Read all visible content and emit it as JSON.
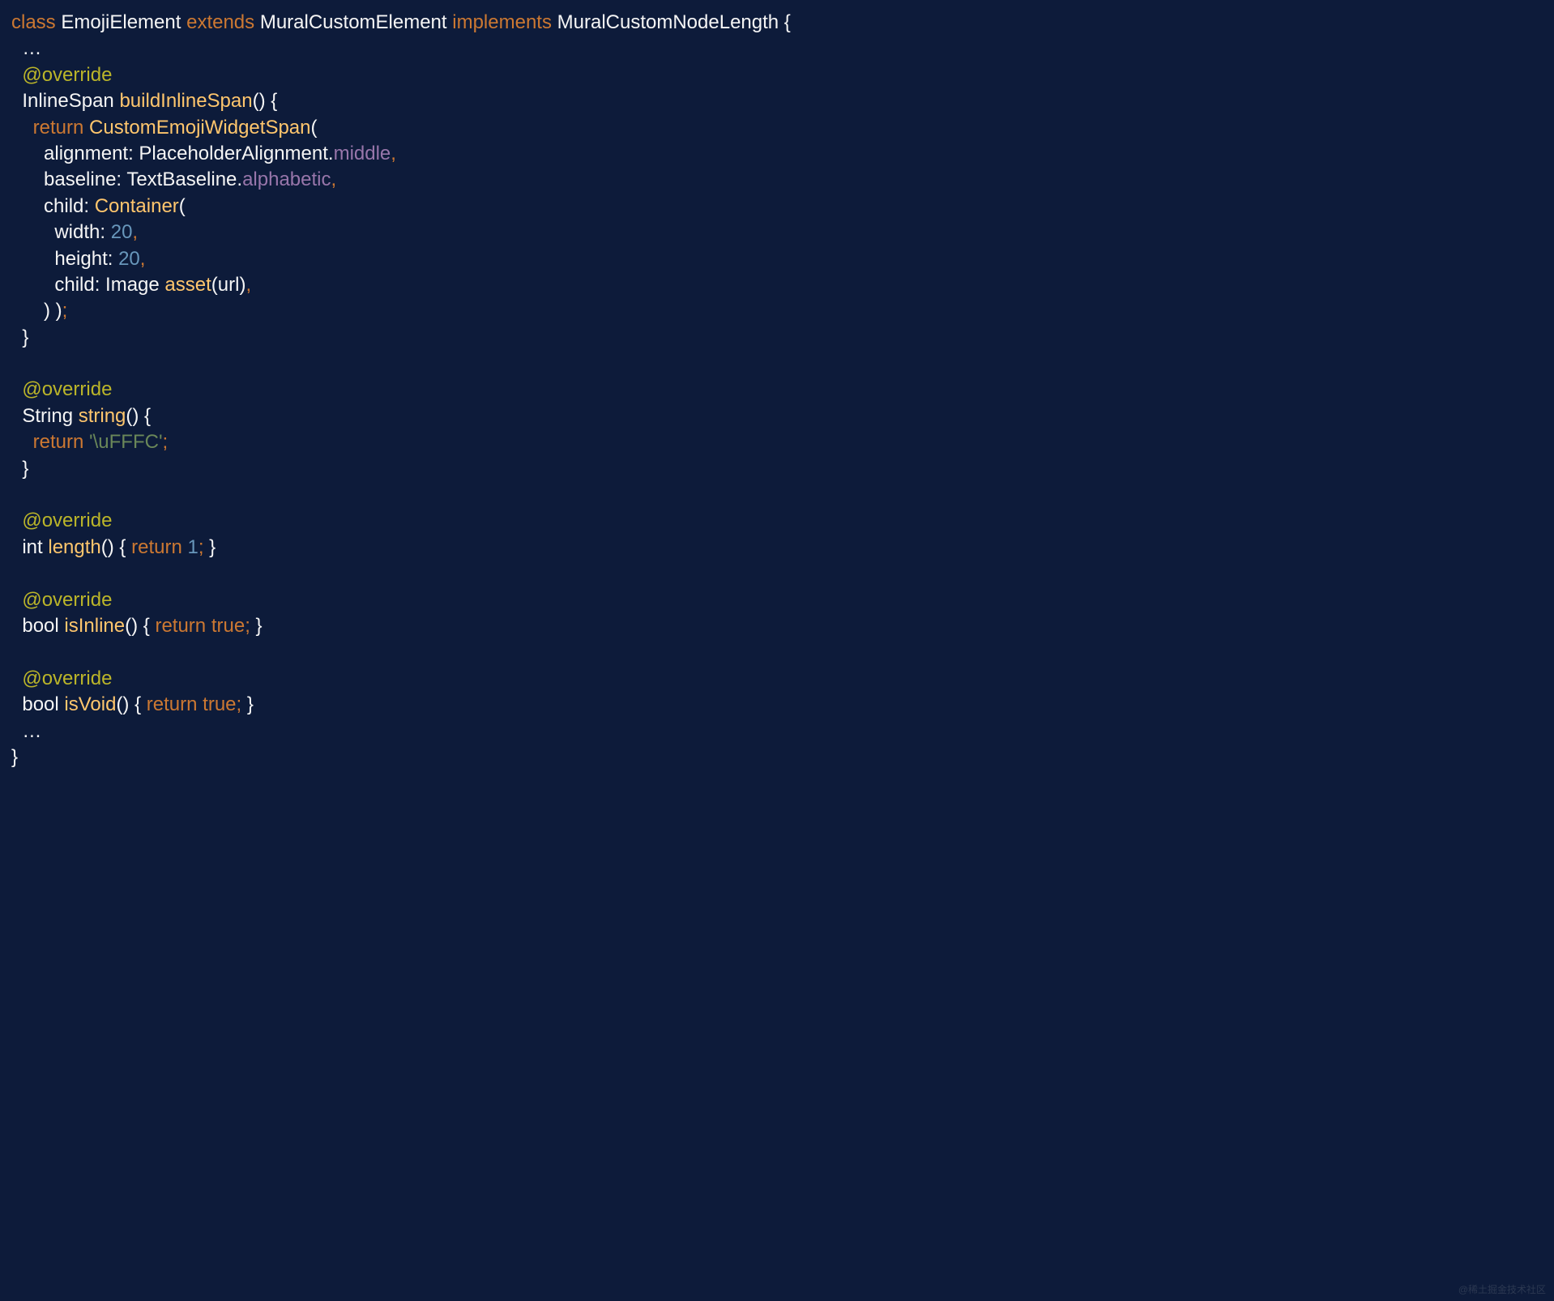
{
  "code": {
    "l1": {
      "kw1": "class",
      "cls": "EmojiElement",
      "kw2": "extends",
      "sup": "MuralCustomElement",
      "kw3": "implements",
      "iface": "MuralCustomNodeLength",
      "b": "{"
    },
    "l2": {
      "dots": "…"
    },
    "l3": {
      "ann": "@override"
    },
    "l4": {
      "type": "InlineSpan",
      "fn": "buildInlineSpan",
      "p": "() {"
    },
    "l5": {
      "kw": "return",
      "fn": "CustomEmojiWidgetSpan",
      "p": "("
    },
    "l6": {
      "param": "alignment: ",
      "cls": "PlaceholderAlignment",
      "dot": ".",
      "enum": "middle",
      "c": ","
    },
    "l7": {
      "param": "baseline: ",
      "cls": "TextBaseline",
      "dot": ".",
      "enum": "alphabetic",
      "c": ","
    },
    "l8": {
      "param": "child: ",
      "fn": "Container",
      "p": "("
    },
    "l9": {
      "param": "width: ",
      "num": "20",
      "c": ","
    },
    "l10": {
      "param": "height: ",
      "num": "20",
      "c": ","
    },
    "l11": {
      "param": "child: ",
      "cls": "Image",
      "sp": " ",
      "fn": "asset",
      "p": "(url)",
      "c": ","
    },
    "l12": {
      "p": ") )",
      "c": ";"
    },
    "l13": {
      "b": "}"
    },
    "l14": {
      "ann": "@override"
    },
    "l15": {
      "type": "String",
      "fn": "string",
      "p": "() {"
    },
    "l16": {
      "kw": "return",
      "str": "'\\uFFFC'",
      "c": ";"
    },
    "l17": {
      "b": "}"
    },
    "l18": {
      "ann": "@override"
    },
    "l19": {
      "type": "int",
      "fn": "length",
      "p": "() { ",
      "kw": "return",
      "num": "1",
      "c": ";",
      "e": " }"
    },
    "l20": {
      "ann": "@override"
    },
    "l21": {
      "type": "bool",
      "fn": "isInline",
      "p": "() { ",
      "kw": "return",
      "val": "true",
      "c": ";",
      "e": " }"
    },
    "l22": {
      "ann": "@override"
    },
    "l23": {
      "type": "bool",
      "fn": "isVoid",
      "p": "() { ",
      "kw": "return",
      "val": "true",
      "c": ";",
      "e": " }"
    },
    "l24": {
      "dots": "…"
    },
    "l25": {
      "b": "}"
    }
  },
  "watermark": "@稀土掘金技术社区"
}
